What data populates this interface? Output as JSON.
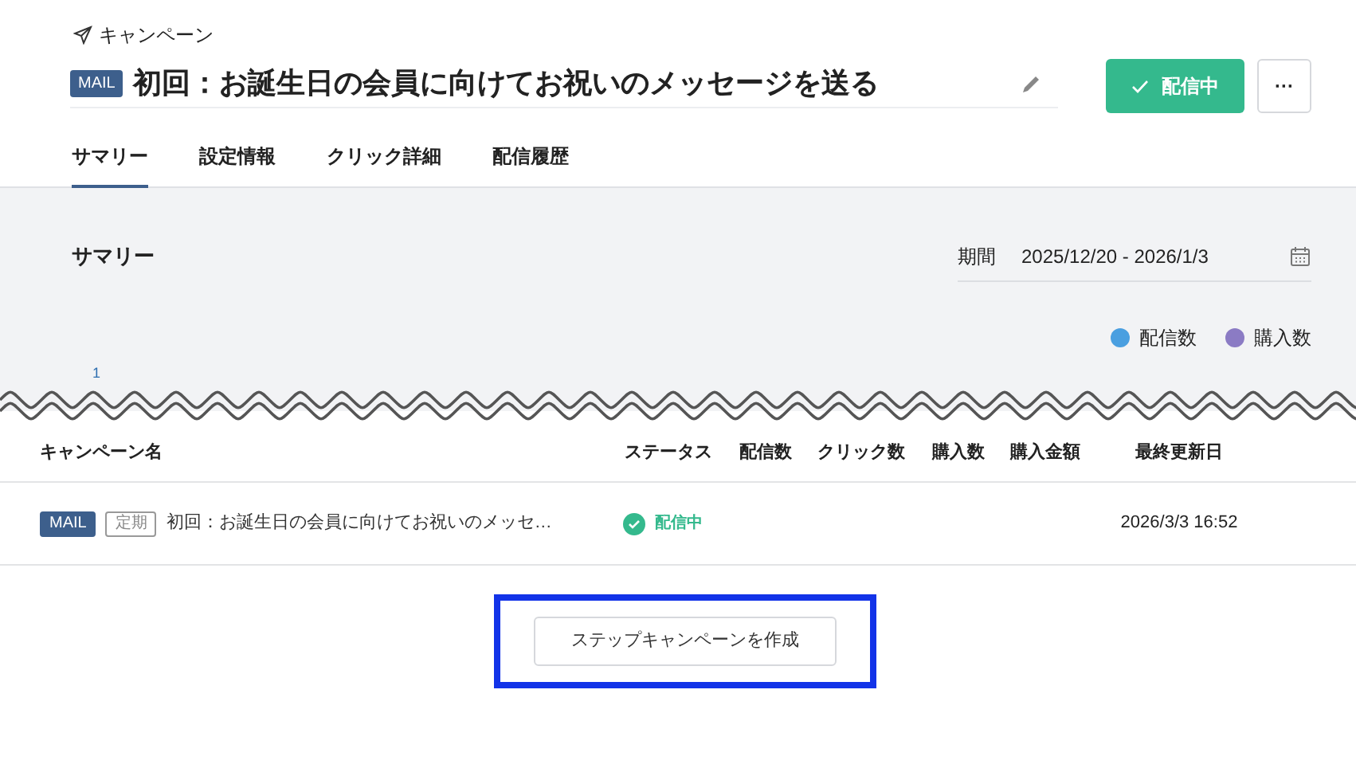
{
  "breadcrumb": {
    "label": "キャンペーン"
  },
  "title": {
    "badge": "MAIL",
    "text": "初回：お誕生日の会員に向けてお祝いのメッセージを送る"
  },
  "status_button": {
    "label": "配信中"
  },
  "more_button": {
    "label": "···"
  },
  "tabs": [
    {
      "label": "サマリー",
      "selected": true
    },
    {
      "label": "設定情報",
      "selected": false
    },
    {
      "label": "クリック詳細",
      "selected": false
    },
    {
      "label": "配信履歴",
      "selected": false
    }
  ],
  "summary": {
    "title": "サマリー",
    "period_label": "期間",
    "period": "2025/12/20 - 2026/1/3",
    "axis_label": "1",
    "legend": [
      {
        "label": "配信数",
        "color": "#4a9fe0"
      },
      {
        "label": "購入数",
        "color": "#8b7bc4"
      }
    ]
  },
  "table": {
    "columns": [
      "キャンペーン名",
      "ステータス",
      "配信数",
      "クリック数",
      "購入数",
      "購入金額",
      "最終更新日"
    ],
    "rows": [
      {
        "badges": [
          {
            "label": "MAIL",
            "kind": "filled"
          },
          {
            "label": "定期",
            "kind": "outline"
          }
        ],
        "name": "初回：お誕生日の会員に向けてお祝いのメッセ…",
        "status": "配信中",
        "last_updated": "2026/3/3 16:52"
      }
    ]
  },
  "create_button": {
    "label": "ステップキャンペーンを作成",
    "highlighted": true
  }
}
